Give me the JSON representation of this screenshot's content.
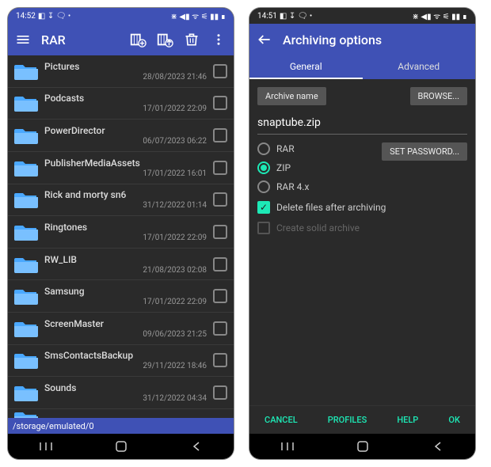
{
  "left": {
    "status": {
      "time": "14:52",
      "icons_left": "◧ ↧ 🗨 •",
      "icons_right": "⋇ ◀▮ ᯤ ⚟ ▮▮ ∎"
    },
    "app_title": "RAR",
    "files": [
      {
        "name": "Pictures",
        "date": "28/08/2023 21:46"
      },
      {
        "name": "Podcasts",
        "date": "17/01/2022 22:09"
      },
      {
        "name": "PowerDirector",
        "date": "06/07/2023 06:22"
      },
      {
        "name": "PublisherMediaAssets",
        "date": "17/01/2022 16:01"
      },
      {
        "name": "Rick and morty sn6",
        "date": "31/12/2022 01:14"
      },
      {
        "name": "Ringtones",
        "date": "17/01/2022 22:09"
      },
      {
        "name": "RW_LIB",
        "date": "21/08/2023 02:08"
      },
      {
        "name": "Samsung",
        "date": "17/01/2022 22:09"
      },
      {
        "name": "ScreenMaster",
        "date": "09/06/2023 21:25"
      },
      {
        "name": "SmsContactsBackup",
        "date": "29/11/2022 18:46"
      },
      {
        "name": "Sounds",
        "date": "31/12/2022 04:34"
      }
    ],
    "path": "/storage/emulated/0"
  },
  "right": {
    "status": {
      "time": "14:51",
      "icons_left": "◧ ↧ 🗨 •",
      "icons_right": "⋇ ◀▮ ᯤ ⚟ ▮▮ ∎"
    },
    "title": "Archiving options",
    "tabs": {
      "general": "General",
      "advanced": "Advanced"
    },
    "archive_name_label": "Archive name",
    "browse": "BROWSE...",
    "archive_name_value": "snaptube.zip",
    "formats": {
      "rar": "RAR",
      "zip": "ZIP",
      "rar4x": "RAR 4.x"
    },
    "set_password": "SET PASSWORD...",
    "delete_after": "Delete files after archiving",
    "solid_archive": "Create solid archive",
    "actions": {
      "cancel": "CANCEL",
      "profiles": "PROFILES",
      "help": "HELP",
      "ok": "OK"
    }
  }
}
